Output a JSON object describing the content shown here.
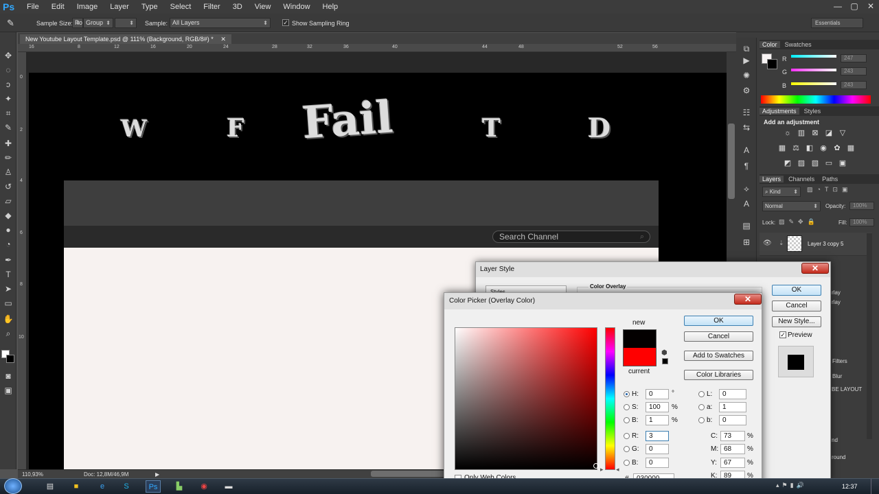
{
  "app": {
    "logo": "Ps"
  },
  "menu": [
    "File",
    "Edit",
    "Image",
    "Layer",
    "Type",
    "Select",
    "Filter",
    "3D",
    "View",
    "Window",
    "Help"
  ],
  "window_controls": [
    "—",
    "▢",
    "✕"
  ],
  "options": {
    "sample_size_label": "Sample Size:",
    "sample_size_value": "Po",
    "group_value": "Group",
    "sample_label": "Sample:",
    "sample_value": "All Layers",
    "show_ring_label": "Show Sampling Ring",
    "workspace": "Essentials"
  },
  "document": {
    "tab_title": "New Youtube Layout Template.psd @ 111% (Background, RGB/8#) *",
    "ruler_h": [
      "16",
      "8",
      "12",
      "16",
      "20",
      "24",
      "28",
      "32",
      "36",
      "40",
      "44",
      "48",
      "52",
      "56"
    ],
    "ruler_v": [
      "0",
      "2",
      "4",
      "6",
      "8",
      "10"
    ],
    "graffiti_letters": [
      "W",
      "F",
      "Fail",
      "T",
      "D"
    ],
    "search_placeholder": "Search Channel"
  },
  "status": {
    "zoom": "110,93%",
    "doc": "Doc: 12,8M/46,9M"
  },
  "color_panel": {
    "tabs": [
      "Color",
      "Swatches"
    ],
    "channels": [
      {
        "label": "R",
        "value": "247",
        "color": "#00e5ff"
      },
      {
        "label": "G",
        "value": "243",
        "color": "#ff40ff"
      },
      {
        "label": "B",
        "value": "243",
        "color": "#ffff00"
      }
    ]
  },
  "adjustments_panel": {
    "tabs": [
      "Adjustments",
      "Styles"
    ],
    "heading": "Add an adjustment"
  },
  "layers_panel": {
    "tabs": [
      "Layers",
      "Channels",
      "Paths"
    ],
    "kind": "Kind",
    "blend_mode": "Normal",
    "opacity_label": "Opacity:",
    "opacity_value": "100%",
    "lock_label": "Lock:",
    "fill_label": "Fill:",
    "fill_value": "100%",
    "layer_name": "Layer 3 copy 5",
    "peek_labels": [
      "rlay",
      "rlay",
      "Filters",
      "Blur",
      "BE LAYOUT",
      "nd",
      "round"
    ]
  },
  "layer_style": {
    "title": "Layer Style",
    "styles_header": "Styles",
    "section_title": "Color Overlay",
    "ok": "OK",
    "cancel": "Cancel",
    "new_style": "New Style...",
    "preview": "Preview"
  },
  "color_picker": {
    "title": "Color Picker (Overlay Color)",
    "new_label": "new",
    "current_label": "current",
    "new_color": "#030000",
    "current_color": "#ff0000",
    "ok": "OK",
    "cancel": "Cancel",
    "add_to_swatches": "Add to Swatches",
    "color_libraries": "Color Libraries",
    "hsb": [
      {
        "label": "H:",
        "value": "0",
        "unit": "°"
      },
      {
        "label": "S:",
        "value": "100",
        "unit": "%"
      },
      {
        "label": "B:",
        "value": "1",
        "unit": "%"
      }
    ],
    "rgb": [
      {
        "label": "R:",
        "value": "3"
      },
      {
        "label": "G:",
        "value": "0"
      },
      {
        "label": "B:",
        "value": "0"
      }
    ],
    "lab": [
      {
        "label": "L:",
        "value": "0"
      },
      {
        "label": "a:",
        "value": "1"
      },
      {
        "label": "b:",
        "value": "0"
      }
    ],
    "cmyk": [
      {
        "label": "C:",
        "value": "73",
        "unit": "%"
      },
      {
        "label": "M:",
        "value": "68",
        "unit": "%"
      },
      {
        "label": "Y:",
        "value": "67",
        "unit": "%"
      },
      {
        "label": "K:",
        "value": "89",
        "unit": "%"
      }
    ],
    "hex_label": "#",
    "hex": "030000",
    "web_only": "Only Web Colors"
  },
  "taskbar": {
    "clock": "12:37"
  }
}
